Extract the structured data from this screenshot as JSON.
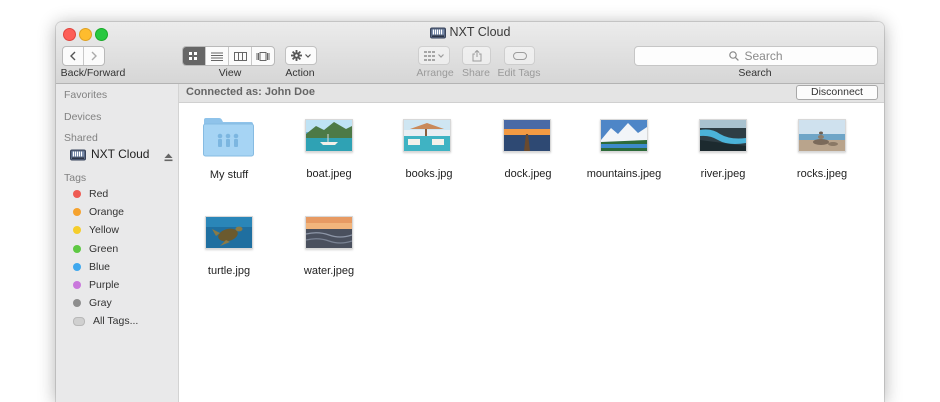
{
  "window": {
    "title": "NXT Cloud"
  },
  "toolbar": {
    "back_forward_label": "Back/Forward",
    "view_label": "View",
    "action_label": "Action",
    "arrange_label": "Arrange",
    "share_label": "Share",
    "edit_tags_label": "Edit Tags",
    "search_label": "Search",
    "search_placeholder": "Search"
  },
  "sidebar": {
    "favorites": "Favorites",
    "devices": "Devices",
    "shared": "Shared",
    "shared_item": "NXT Cloud",
    "tags_header": "Tags",
    "tags": [
      {
        "label": "Red",
        "color": "#ee5a52"
      },
      {
        "label": "Orange",
        "color": "#f5a22e"
      },
      {
        "label": "Yellow",
        "color": "#f5cd2b"
      },
      {
        "label": "Green",
        "color": "#5ec843"
      },
      {
        "label": "Blue",
        "color": "#3fa8ee"
      },
      {
        "label": "Purple",
        "color": "#c978dc"
      },
      {
        "label": "Gray",
        "color": "#8e8e8e"
      },
      {
        "label": "All Tags...",
        "color": "#d0d0d0"
      }
    ]
  },
  "pathbar": {
    "connected": "Connected as: John Doe",
    "disconnect": "Disconnect"
  },
  "files": [
    {
      "name": "My stuff",
      "kind": "folder"
    },
    {
      "name": "boat.jpeg",
      "kind": "image"
    },
    {
      "name": "books.jpg",
      "kind": "image"
    },
    {
      "name": "dock.jpeg",
      "kind": "image"
    },
    {
      "name": "mountains.jpeg",
      "kind": "image"
    },
    {
      "name": "river.jpeg",
      "kind": "image"
    },
    {
      "name": "rocks.jpeg",
      "kind": "image"
    },
    {
      "name": "turtle.jpg",
      "kind": "image"
    },
    {
      "name": "water.jpeg",
      "kind": "image"
    }
  ]
}
